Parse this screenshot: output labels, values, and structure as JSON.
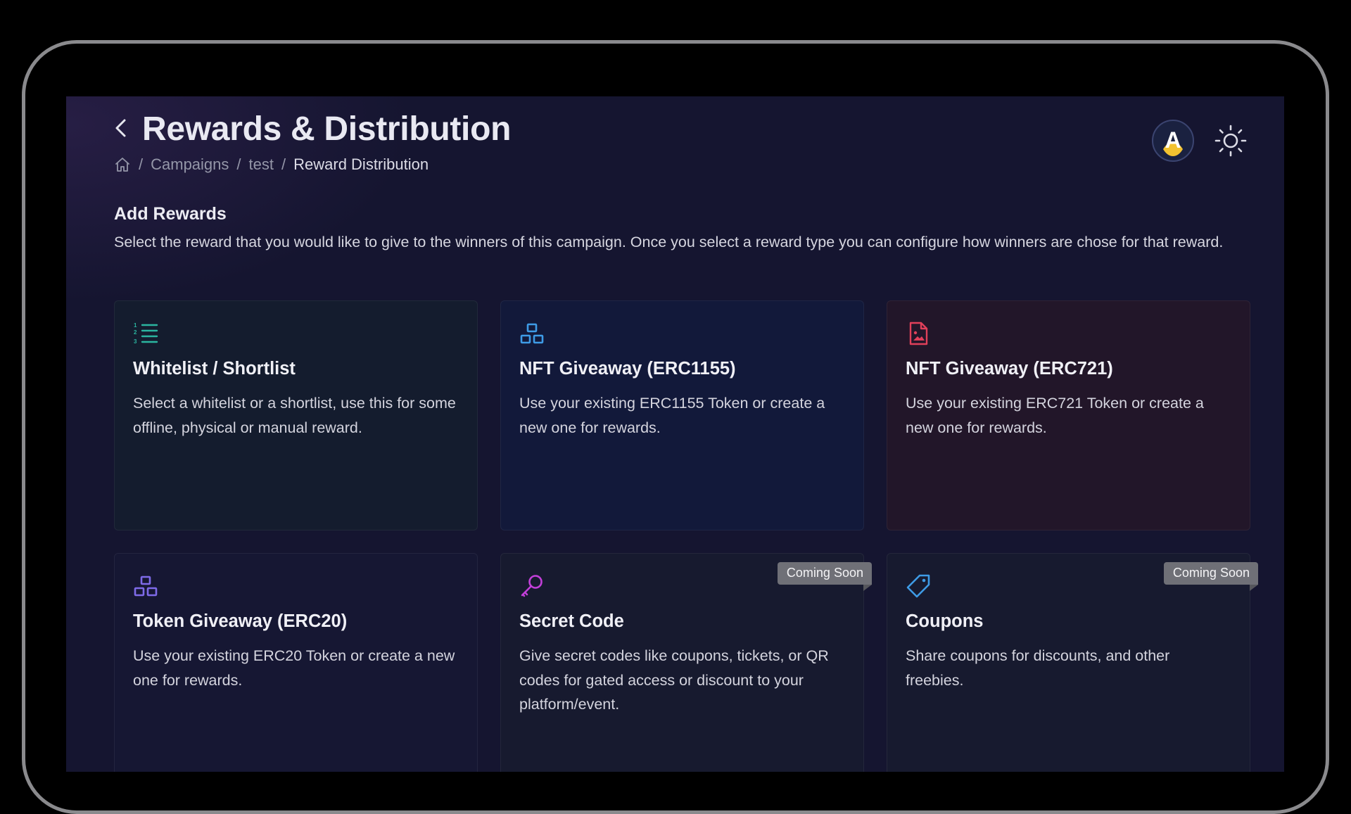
{
  "page": {
    "title": "Rewards & Distribution",
    "breadcrumb": {
      "separator": "/",
      "items": [
        "Campaigns",
        "test",
        "Reward Distribution"
      ]
    },
    "avatar_letter": "A"
  },
  "section": {
    "title": "Add Rewards",
    "description": "Select the reward that you would like to give to the winners of this campaign. Once you select a reward type you can configure how winners are chose for that reward."
  },
  "cards": [
    {
      "icon": "numbered-list-icon",
      "color": "#2bb5a0",
      "title": "Whitelist / Shortlist",
      "description": "Select a whitelist or a shortlist, use this for some offline, physical or manual reward.",
      "badge": ""
    },
    {
      "icon": "cubes-icon",
      "color": "#3e9be6",
      "title": "NFT Giveaway (ERC1155)",
      "description": "Use your existing ERC1155 Token or create a new one for rewards.",
      "badge": ""
    },
    {
      "icon": "image-file-icon",
      "color": "#e0405a",
      "title": "NFT Giveaway (ERC721)",
      "description": "Use your existing ERC721 Token or create a new one for rewards.",
      "badge": ""
    },
    {
      "icon": "cubes-icon",
      "color": "#7e6ae8",
      "title": "Token Giveaway (ERC20)",
      "description": "Use your existing ERC20 Token or create a new one for rewards.",
      "badge": ""
    },
    {
      "icon": "key-icon",
      "color": "#c23fd9",
      "title": "Secret Code",
      "description": "Give secret codes like coupons, tickets, or QR codes for gated access or discount to your platform/event.",
      "badge": "Coming Soon"
    },
    {
      "icon": "tag-icon",
      "color": "#3e9be6",
      "title": "Coupons",
      "description": "Share coupons for discounts, and other freebies.",
      "badge": "Coming Soon"
    }
  ]
}
